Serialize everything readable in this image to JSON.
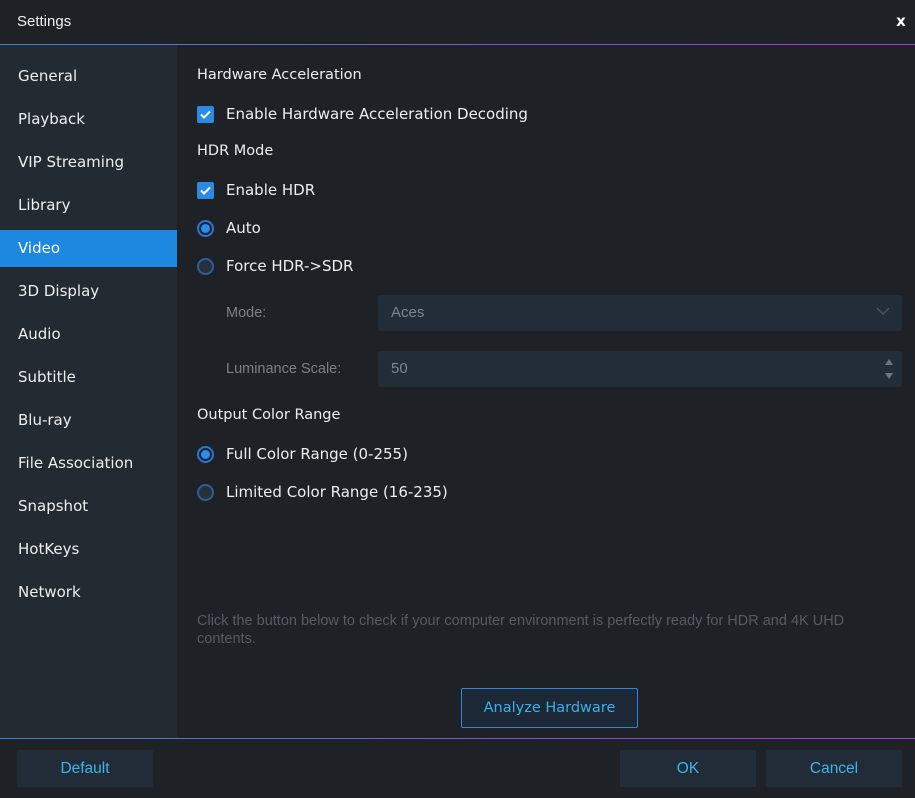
{
  "window": {
    "title": "Settings",
    "close_glyph": "x"
  },
  "sidebar": {
    "active_index": 4,
    "items": [
      {
        "label": "General"
      },
      {
        "label": "Playback"
      },
      {
        "label": "VIP Streaming"
      },
      {
        "label": "Library"
      },
      {
        "label": "Video"
      },
      {
        "label": "3D Display"
      },
      {
        "label": "Audio"
      },
      {
        "label": "Subtitle"
      },
      {
        "label": "Blu-ray"
      },
      {
        "label": "File Association"
      },
      {
        "label": "Snapshot"
      },
      {
        "label": "HotKeys"
      },
      {
        "label": "Network"
      }
    ]
  },
  "video": {
    "hardware_acceleration": {
      "title": "Hardware Acceleration",
      "enable_decoding": {
        "label": "Enable Hardware Acceleration Decoding",
        "checked": true
      }
    },
    "hdr_mode": {
      "title": "HDR Mode",
      "enable_hdr": {
        "label": "Enable HDR",
        "checked": true
      },
      "options": [
        {
          "label": "Auto",
          "selected": true
        },
        {
          "label": "Force HDR->SDR",
          "selected": false
        }
      ],
      "mode": {
        "label": "Mode:",
        "value": "Aces",
        "disabled": true
      },
      "luminance_scale": {
        "label": "Luminance Scale:",
        "value": "50",
        "disabled": true
      }
    },
    "output_color_range": {
      "title": "Output Color Range",
      "options": [
        {
          "label": "Full Color Range (0-255)",
          "selected": true
        },
        {
          "label": "Limited Color Range (16-235)",
          "selected": false
        }
      ]
    },
    "hint": "Click the button below to check if your computer environment is perfectly ready for HDR and 4K UHD contents.",
    "analyze_button": "Analyze Hardware"
  },
  "footer": {
    "default_button": "Default",
    "ok_button": "OK",
    "cancel_button": "Cancel"
  },
  "colors": {
    "accent": "#1e87e0",
    "button_text": "#39b6e8",
    "background": "#1e2126",
    "sidebar": "#242a31"
  }
}
